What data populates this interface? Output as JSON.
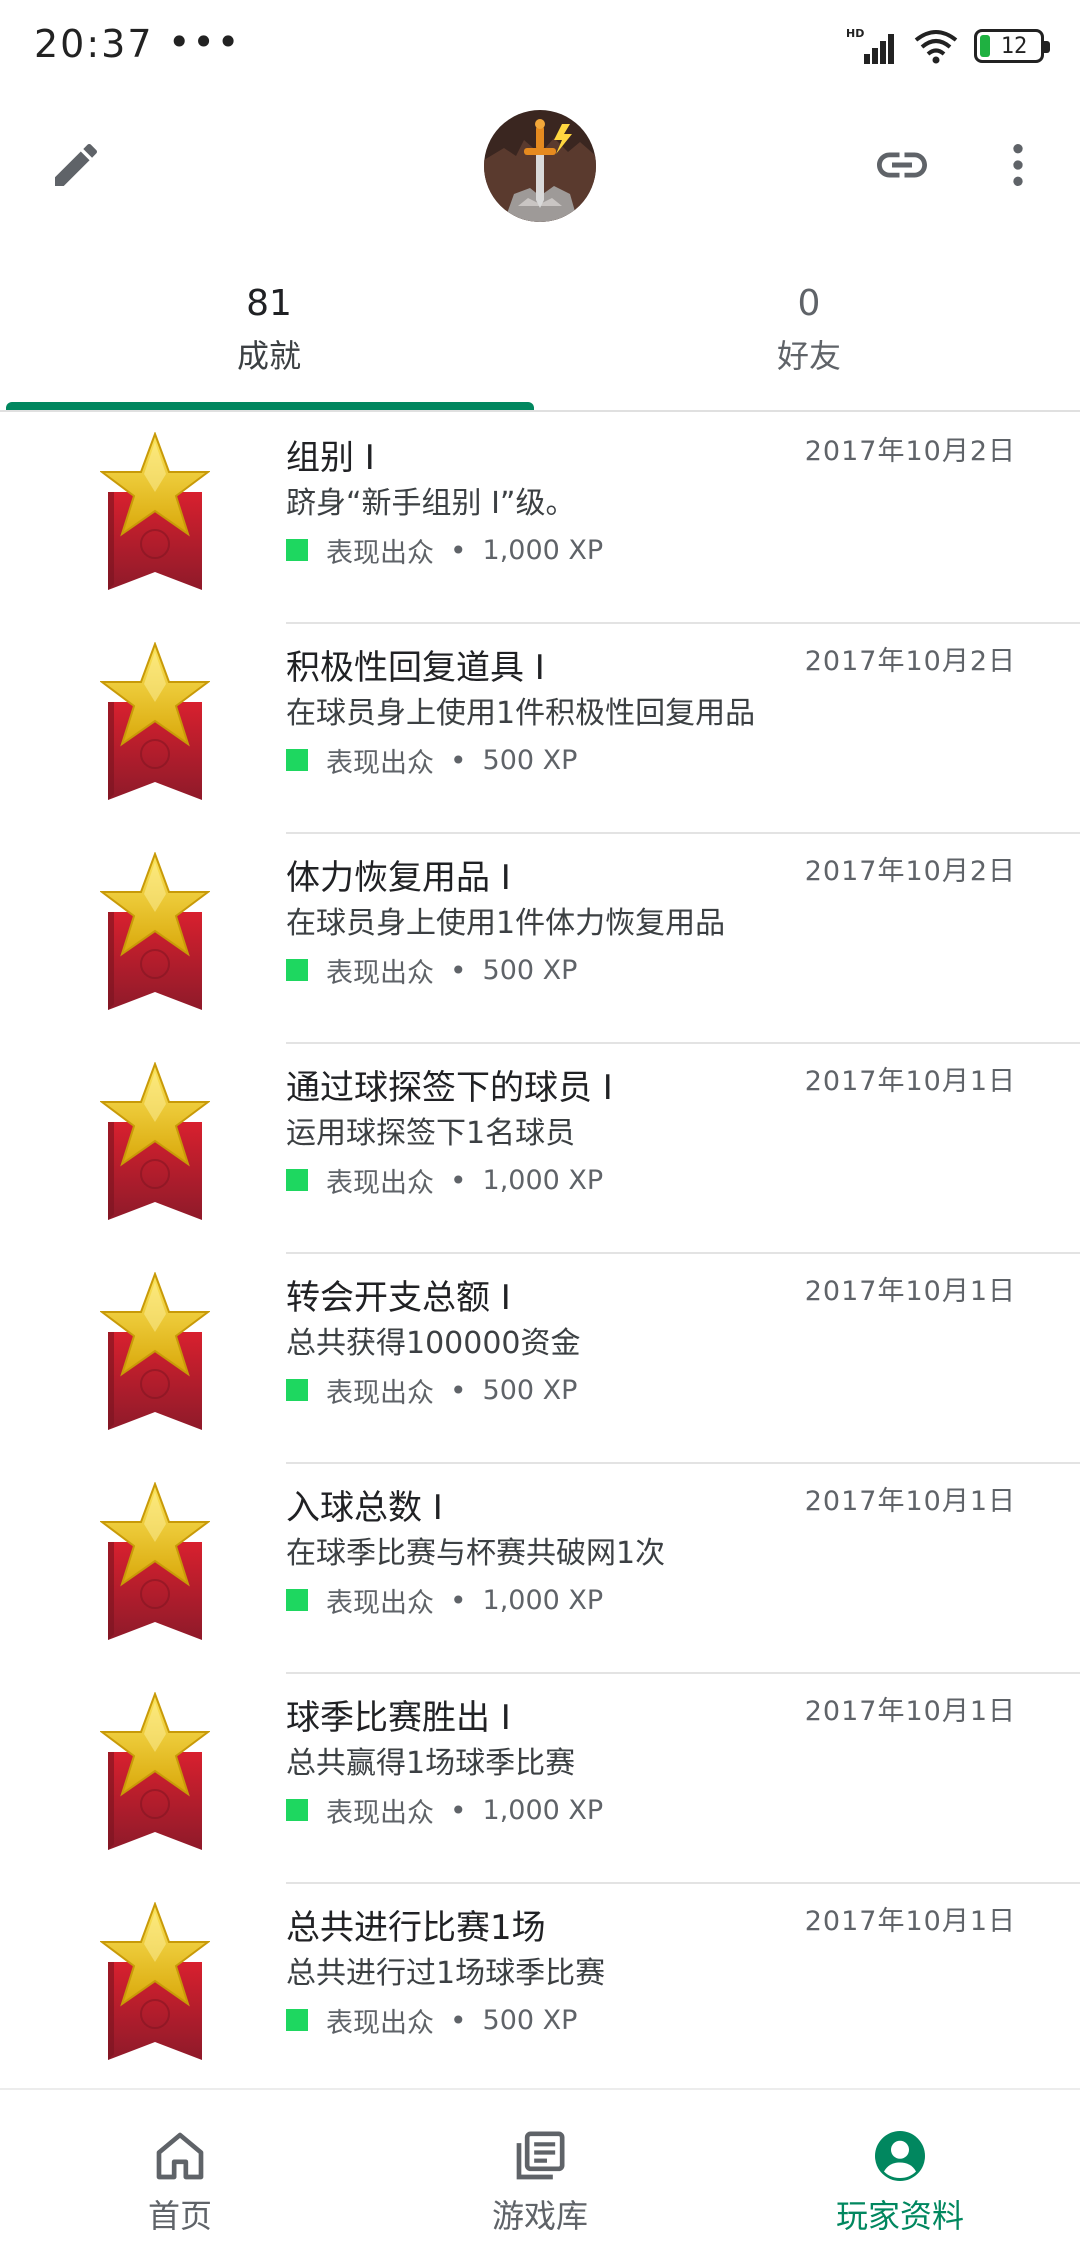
{
  "status_bar": {
    "time": "20:37",
    "dots": "•••",
    "network": "HD",
    "battery": "12"
  },
  "app_bar": {
    "edit_icon": "pencil-icon",
    "link_icon": "link-icon",
    "more_icon": "more-vert-icon",
    "avatar_icon": "sword-in-stone-avatar"
  },
  "tabs": [
    {
      "count": "81",
      "label": "成就",
      "selected": true
    },
    {
      "count": "0",
      "label": "好友",
      "selected": false
    }
  ],
  "colors": {
    "accent": "#01875f",
    "rarity": "#1ed760",
    "badge_star": "#f2c40f",
    "badge_ribbon": "#b71c2b"
  },
  "achievements": [
    {
      "title": "组别 I",
      "date": "2017年10月2日",
      "description": "跻身“新手组别 I”级。",
      "rarity": "表现出众",
      "xp": "1,000 XP"
    },
    {
      "title": "积极性回复道具 I",
      "date": "2017年10月2日",
      "description": "在球员身上使用1件积极性回复用品",
      "rarity": "表现出众",
      "xp": "500 XP"
    },
    {
      "title": "体力恢复用品 I",
      "date": "2017年10月2日",
      "description": "在球员身上使用1件体力恢复用品",
      "rarity": "表现出众",
      "xp": "500 XP"
    },
    {
      "title": "通过球探签下的球员 I",
      "date": "2017年10月1日",
      "description": "运用球探签下1名球员",
      "rarity": "表现出众",
      "xp": "1,000 XP"
    },
    {
      "title": "转会开支总额 I",
      "date": "2017年10月1日",
      "description": "总共获得100000资金",
      "rarity": "表现出众",
      "xp": "500 XP"
    },
    {
      "title": "入球总数 I",
      "date": "2017年10月1日",
      "description": "在球季比赛与杯赛共破网1次",
      "rarity": "表现出众",
      "xp": "1,000 XP"
    },
    {
      "title": "球季比赛胜出 I",
      "date": "2017年10月1日",
      "description": "总共赢得1场球季比赛",
      "rarity": "表现出众",
      "xp": "1,000 XP"
    },
    {
      "title": "总共进行比赛1场",
      "date": "2017年10月1日",
      "description": "总共进行过1场球季比赛",
      "rarity": "表现出众",
      "xp": "500 XP"
    }
  ],
  "bottom_nav": [
    {
      "label": "首页",
      "icon": "home-icon",
      "selected": false
    },
    {
      "label": "游戏库",
      "icon": "library-icon",
      "selected": false
    },
    {
      "label": "玩家资料",
      "icon": "account-circle-icon",
      "selected": true
    }
  ]
}
